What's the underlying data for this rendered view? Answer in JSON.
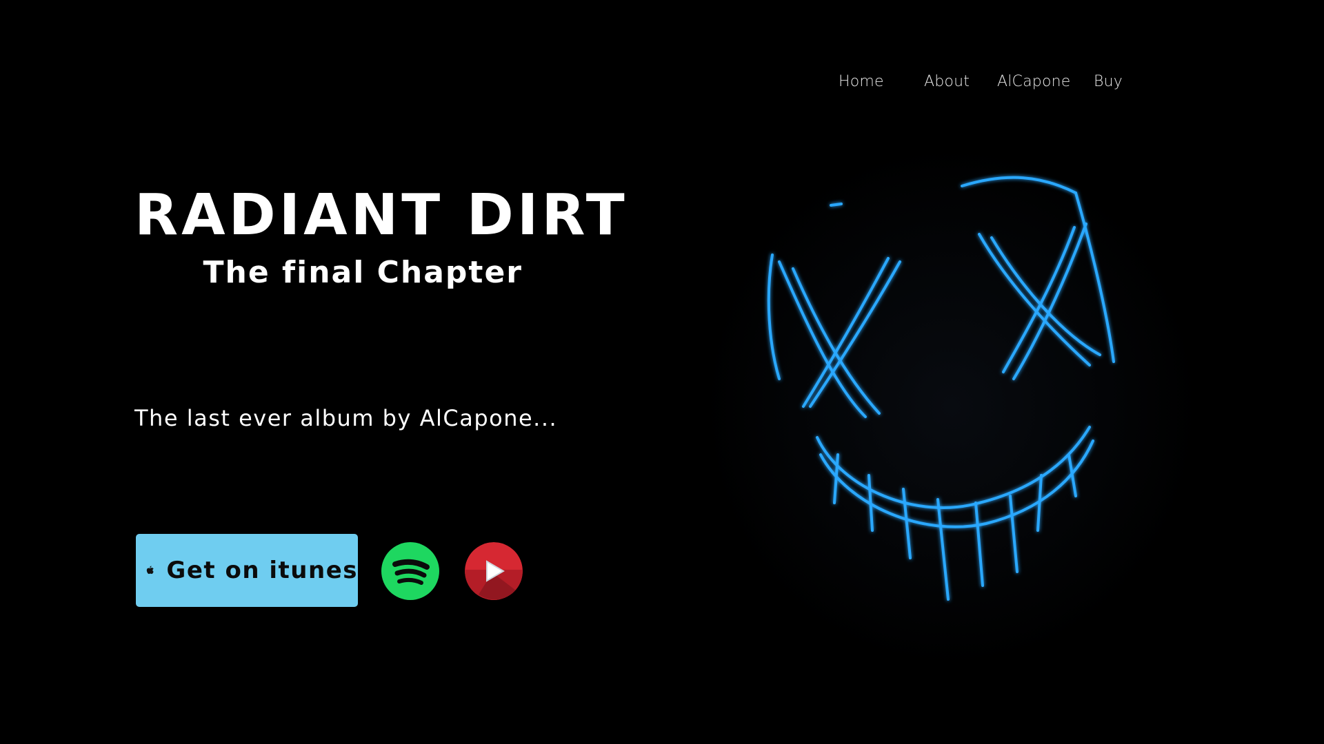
{
  "nav": {
    "items": [
      {
        "label": "Home"
      },
      {
        "label": "About"
      },
      {
        "label": "AlCapone"
      },
      {
        "label": "Buy"
      }
    ]
  },
  "hero": {
    "title": "RADIANT DIRT",
    "subtitle": "The final Chapter",
    "tagline": "The last ever album by AlCapone..."
  },
  "actions": {
    "itunes_label": "Get on itunes",
    "itunes_icon": "apple-icon",
    "spotify_icon": "spotify-icon",
    "youtube_icon": "play-icon"
  },
  "colors": {
    "background": "#000000",
    "itunes_button": "#6fcdf0",
    "spotify": "#1ed760",
    "youtube": "#d62832",
    "neon": "#2aa8ff"
  }
}
